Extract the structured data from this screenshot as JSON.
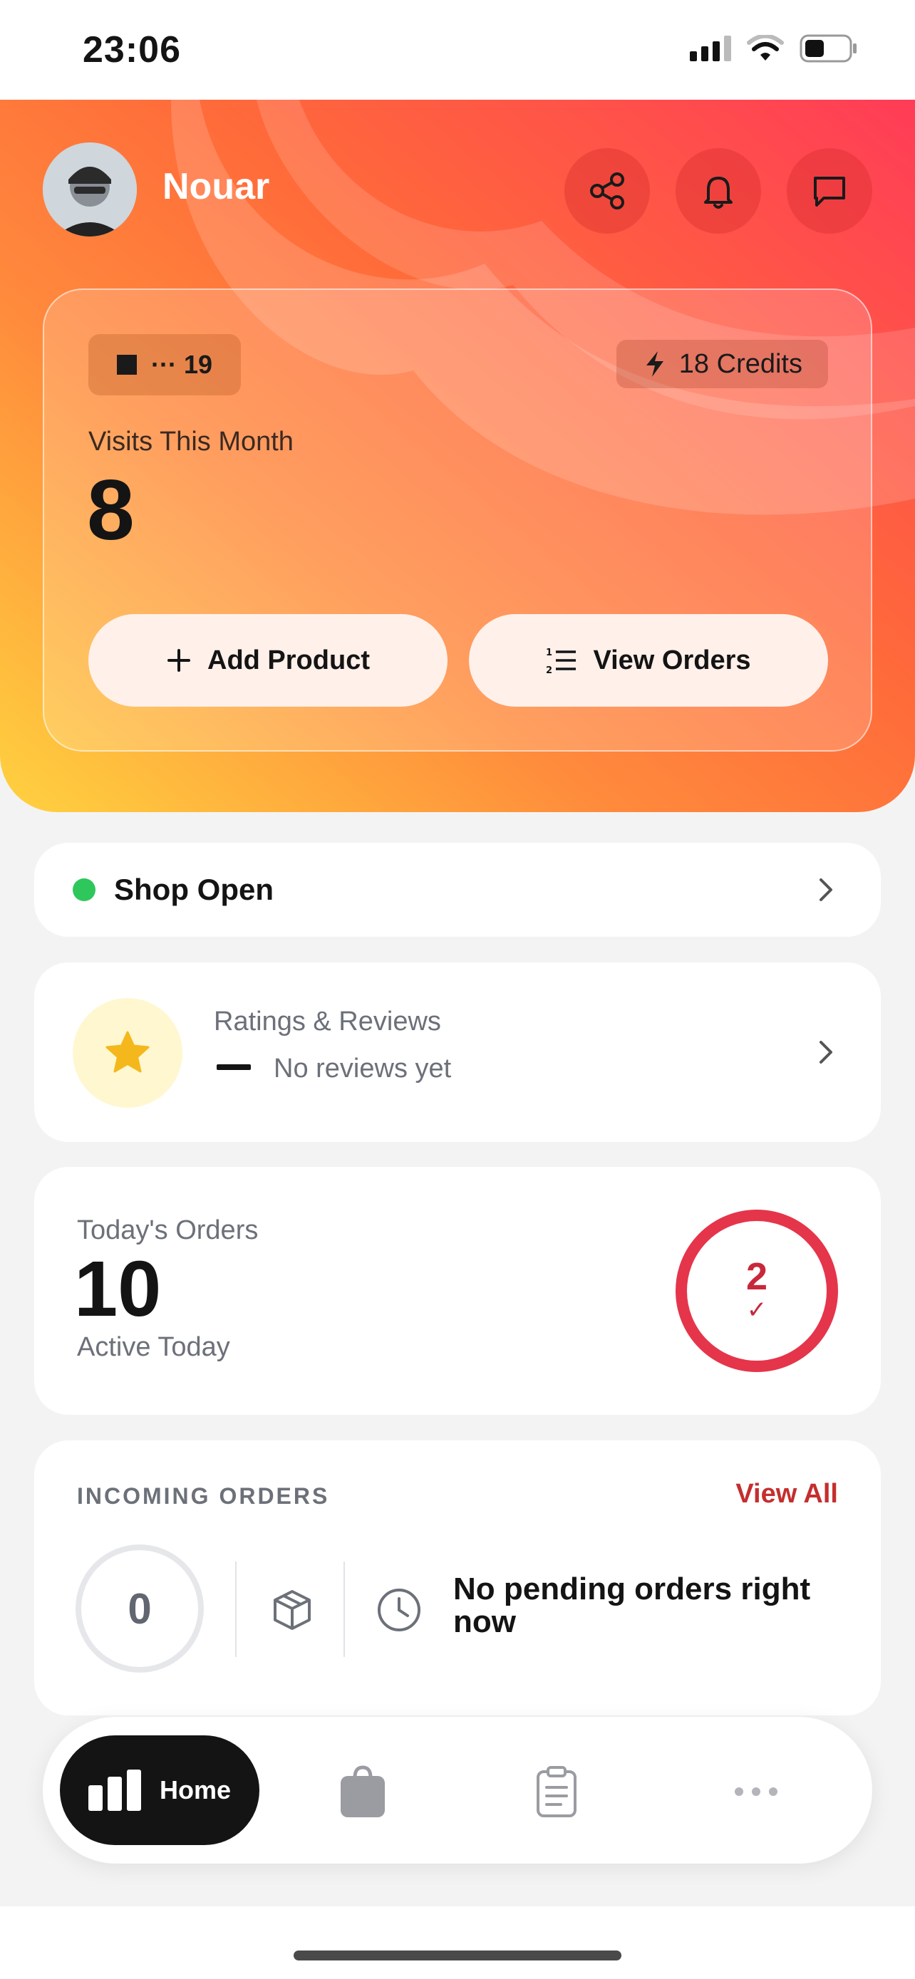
{
  "status_bar": {
    "time": "23:06"
  },
  "header": {
    "username": "Nouar"
  },
  "stats": {
    "tag_text": "··· 19",
    "credits": "18 Credits",
    "visits_label": "Visits This Month",
    "visits_value": "8",
    "add_product": "Add Product",
    "view_orders": "View Orders"
  },
  "shop": {
    "status": "Shop Open",
    "status_color": "#2ec75b"
  },
  "ratings": {
    "title": "Ratings & Reviews",
    "subtitle": "No reviews yet"
  },
  "orders": {
    "label": "Today's Orders",
    "value": "10",
    "sub": "Active Today",
    "ring_value": "2",
    "ring_mark": "✓"
  },
  "incoming": {
    "title": "INCOMING ORDERS",
    "view_all": "View All",
    "count": "0",
    "message": "No pending orders right now"
  },
  "nav": {
    "home": "Home"
  },
  "colors": {
    "accent": "#ff5a3c",
    "danger": "#e5354b",
    "dark": "#141414"
  },
  "icons": [
    "share-icon",
    "bell-icon",
    "chat-icon",
    "bolt-icon",
    "plus-icon",
    "list-icon",
    "chevron-right-icon",
    "star-icon",
    "box-icon",
    "clock-icon",
    "chart-icon",
    "bag-icon",
    "clipboard-icon",
    "more-icon"
  ]
}
